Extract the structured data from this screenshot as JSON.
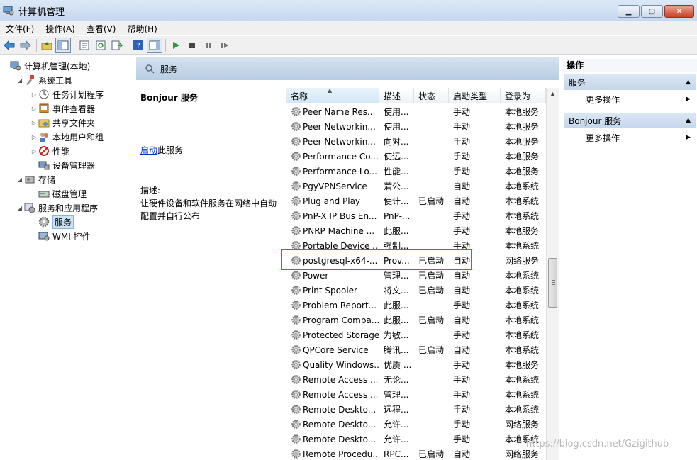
{
  "window": {
    "title": "计算机管理",
    "minimize": "▁",
    "maximize": "▢",
    "close": "✕"
  },
  "menu": [
    "文件(F)",
    "操作(A)",
    "查看(V)",
    "帮助(H)"
  ],
  "tree": [
    {
      "label": "计算机管理(本地)",
      "level": 0,
      "exp": "",
      "icon": "computer-icon"
    },
    {
      "label": "系统工具",
      "level": 1,
      "exp": "◢",
      "icon": "tools-icon"
    },
    {
      "label": "任务计划程序",
      "level": 2,
      "exp": "▷",
      "icon": "clock-icon"
    },
    {
      "label": "事件查看器",
      "level": 2,
      "exp": "▷",
      "icon": "event-viewer-icon"
    },
    {
      "label": "共享文件夹",
      "level": 2,
      "exp": "▷",
      "icon": "shared-folder-icon"
    },
    {
      "label": "本地用户和组",
      "level": 2,
      "exp": "▷",
      "icon": "users-icon"
    },
    {
      "label": "性能",
      "level": 2,
      "exp": "▷",
      "icon": "performance-icon"
    },
    {
      "label": "设备管理器",
      "level": 2,
      "exp": "",
      "icon": "device-manager-icon"
    },
    {
      "label": "存储",
      "level": 1,
      "exp": "◢",
      "icon": "storage-icon"
    },
    {
      "label": "磁盘管理",
      "level": 2,
      "exp": "",
      "icon": "disk-icon"
    },
    {
      "label": "服务和应用程序",
      "level": 1,
      "exp": "◢",
      "icon": "services-apps-icon"
    },
    {
      "label": "服务",
      "level": 2,
      "exp": "",
      "icon": "gear-icon",
      "selected": true
    },
    {
      "label": "WMI 控件",
      "level": 2,
      "exp": "",
      "icon": "wmi-icon"
    }
  ],
  "center": {
    "header": "服务"
  },
  "details": {
    "service_name": "Bonjour 服务",
    "start_link": "启动",
    "start_suffix": "此服务",
    "desc_label": "描述:",
    "desc_text": "让硬件设备和软件服务在网络中自动配置并自行公布"
  },
  "list": {
    "columns": [
      "名称",
      "描述",
      "状态",
      "启动类型",
      "登录为"
    ],
    "rows": [
      {
        "name": "Peer Name Res...",
        "desc": "使用...",
        "status": "",
        "start": "手动",
        "logon": "本地服务"
      },
      {
        "name": "Peer Networkin...",
        "desc": "使用...",
        "status": "",
        "start": "手动",
        "logon": "本地服务"
      },
      {
        "name": "Peer Networkin...",
        "desc": "向对...",
        "status": "",
        "start": "手动",
        "logon": "本地服务"
      },
      {
        "name": "Performance Co...",
        "desc": "使远...",
        "status": "",
        "start": "手动",
        "logon": "本地服务"
      },
      {
        "name": "Performance Lo...",
        "desc": "性能...",
        "status": "",
        "start": "手动",
        "logon": "本地服务"
      },
      {
        "name": "PgyVPNService",
        "desc": "蒲公...",
        "status": "",
        "start": "自动",
        "logon": "本地系统"
      },
      {
        "name": "Plug and Play",
        "desc": "使计...",
        "status": "已启动",
        "start": "自动",
        "logon": "本地系统"
      },
      {
        "name": "PnP-X IP Bus En...",
        "desc": "PnP-...",
        "status": "",
        "start": "手动",
        "logon": "本地系统"
      },
      {
        "name": "PNRP Machine ...",
        "desc": "此服...",
        "status": "",
        "start": "手动",
        "logon": "本地服务"
      },
      {
        "name": "Portable Device ...",
        "desc": "强制...",
        "status": "",
        "start": "手动",
        "logon": "本地系统"
      },
      {
        "name": "postgresql-x64-...",
        "desc": "Prov...",
        "status": "已启动",
        "start": "自动",
        "logon": "网络服务"
      },
      {
        "name": "Power",
        "desc": "管理...",
        "status": "已启动",
        "start": "自动",
        "logon": "本地系统"
      },
      {
        "name": "Print Spooler",
        "desc": "将文...",
        "status": "已启动",
        "start": "自动",
        "logon": "本地系统"
      },
      {
        "name": "Problem Report...",
        "desc": "此服...",
        "status": "",
        "start": "手动",
        "logon": "本地系统"
      },
      {
        "name": "Program Compa...",
        "desc": "此服...",
        "status": "已启动",
        "start": "自动",
        "logon": "本地系统"
      },
      {
        "name": "Protected Storage",
        "desc": "为敏...",
        "status": "",
        "start": "手动",
        "logon": "本地系统"
      },
      {
        "name": "QPCore Service",
        "desc": "腾讯...",
        "status": "已启动",
        "start": "自动",
        "logon": "本地系统"
      },
      {
        "name": "Quality Windows...",
        "desc": "优质 ...",
        "status": "",
        "start": "手动",
        "logon": "本地服务"
      },
      {
        "name": "Remote Access ...",
        "desc": "无论...",
        "status": "",
        "start": "手动",
        "logon": "本地系统"
      },
      {
        "name": "Remote Access ...",
        "desc": "管理...",
        "status": "",
        "start": "手动",
        "logon": "本地系统"
      },
      {
        "name": "Remote Deskto...",
        "desc": "远程...",
        "status": "",
        "start": "手动",
        "logon": "本地系统"
      },
      {
        "name": "Remote Deskto...",
        "desc": "允许...",
        "status": "",
        "start": "手动",
        "logon": "网络服务"
      },
      {
        "name": "Remote Deskto...",
        "desc": "允许...",
        "status": "",
        "start": "手动",
        "logon": "本地系统"
      },
      {
        "name": "Remote Procedu...",
        "desc": "RPC...",
        "status": "已启动",
        "start": "自动",
        "logon": "网络服务"
      }
    ]
  },
  "actions": {
    "title": "操作",
    "sections": [
      {
        "label": "服务",
        "item": "更多操作"
      },
      {
        "label": "Bonjour 服务",
        "item": "更多操作"
      }
    ]
  },
  "watermark": "https://blog.csdn.net/Gzigithub"
}
